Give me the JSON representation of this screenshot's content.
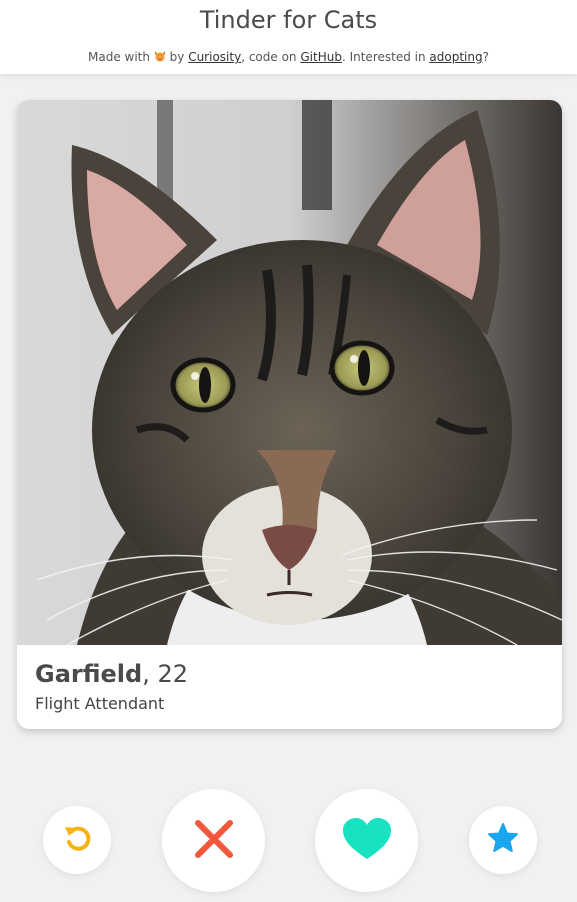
{
  "header": {
    "title": "Tinder for Cats",
    "made_with": "Made with",
    "by": "by",
    "author_link": "Curiosity",
    "code_on": ", code on",
    "github_link": "GitHub",
    "interested_in": ". Interested in",
    "adopting_link": "adopting",
    "question_mark": "?"
  },
  "profile": {
    "name": "Garfield",
    "separator": ",",
    "age": "22",
    "job": "Flight Attendant"
  },
  "actions": {
    "undo_icon": "undo-icon",
    "nope_icon": "close-icon",
    "like_icon": "heart-icon",
    "superlike_icon": "star-icon"
  },
  "colors": {
    "undo": "#f5b30c",
    "nope": "#f2573b",
    "like": "#19e2c1",
    "superlike": "#1aa6ef"
  }
}
